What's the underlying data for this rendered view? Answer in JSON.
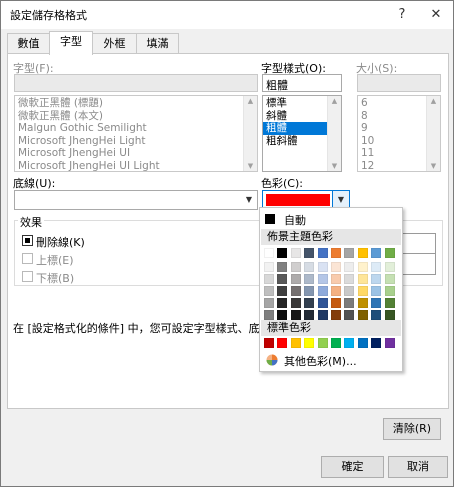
{
  "window": {
    "title": "設定儲存格格式",
    "help": "?",
    "close": "✕"
  },
  "tabs": [
    {
      "label": "數值"
    },
    {
      "label": "字型"
    },
    {
      "label": "外框"
    },
    {
      "label": "填滿"
    }
  ],
  "font": {
    "label": "字型(F):",
    "value": "",
    "items": [
      "微軟正黑體 (標題)",
      "微軟正黑體 (本文)",
      "Malgun Gothic Semilight",
      "Microsoft JhengHei Light",
      "Microsoft JhengHei UI",
      "Microsoft JhengHei UI Light"
    ]
  },
  "style": {
    "label": "字型樣式(O):",
    "value": "粗體",
    "items": [
      "標準",
      "斜體",
      "粗體",
      "粗斜體"
    ],
    "selected_index": 2
  },
  "size": {
    "label": "大小(S):",
    "value": "",
    "items": [
      "6",
      "8",
      "9",
      "10",
      "11",
      "12"
    ]
  },
  "underline": {
    "label": "底線(U):",
    "value": ""
  },
  "color": {
    "label": "色彩(C):",
    "value_color": "#ff0000"
  },
  "effects": {
    "legend": "效果",
    "strike": {
      "label": "刪除線(K)",
      "checked": true
    },
    "superscript": {
      "label": "上標(E)",
      "checked": false
    },
    "subscript": {
      "label": "下標(B)",
      "checked": false
    }
  },
  "info_text": "在 [設定格式化的條件] 中，您可設定字型樣式、底線、色彩",
  "buttons": {
    "clear": "清除(R)",
    "ok": "確定",
    "cancel": "取消"
  },
  "palette": {
    "auto_label": "自動",
    "auto_color": "#000000",
    "theme_label": "佈景主題色彩",
    "theme_top": [
      "#ffffff",
      "#000000",
      "#e7e6e6",
      "#44546a",
      "#4472c4",
      "#ed7d31",
      "#a5a5a5",
      "#ffc000",
      "#5b9bd5",
      "#70ad47"
    ],
    "theme_shades": [
      [
        "#f2f2f2",
        "#808080",
        "#d0cece",
        "#d6dce4",
        "#d9e2f3",
        "#fbe5d5",
        "#ededed",
        "#fff2cc",
        "#ddebf7",
        "#e2efd9"
      ],
      [
        "#d8d8d8",
        "#595959",
        "#aeabab",
        "#adb9ca",
        "#b4c6e7",
        "#f8cbad",
        "#dbdbdb",
        "#fee599",
        "#bdd7ee",
        "#c5e0b3"
      ],
      [
        "#bfbfbf",
        "#404040",
        "#757070",
        "#8496b0",
        "#8eaadb",
        "#f4b183",
        "#c9c9c9",
        "#ffd966",
        "#9cc3e5",
        "#a8d08d"
      ],
      [
        "#a5a5a5",
        "#262626",
        "#3a3838",
        "#323f4f",
        "#2f5496",
        "#c55a11",
        "#7b7b7b",
        "#bf9000",
        "#2e75b5",
        "#538135"
      ],
      [
        "#7f7f7f",
        "#0d0d0d",
        "#171616",
        "#222a35",
        "#1f3864",
        "#833c0b",
        "#525252",
        "#7f6000",
        "#1e4e79",
        "#375623"
      ]
    ],
    "standard_label": "標準色彩",
    "standard": [
      "#c00000",
      "#ff0000",
      "#ffc000",
      "#ffff00",
      "#92d050",
      "#00b050",
      "#00b0f0",
      "#0070c0",
      "#002060",
      "#7030a0"
    ],
    "more_label": "其他色彩(M)..."
  }
}
